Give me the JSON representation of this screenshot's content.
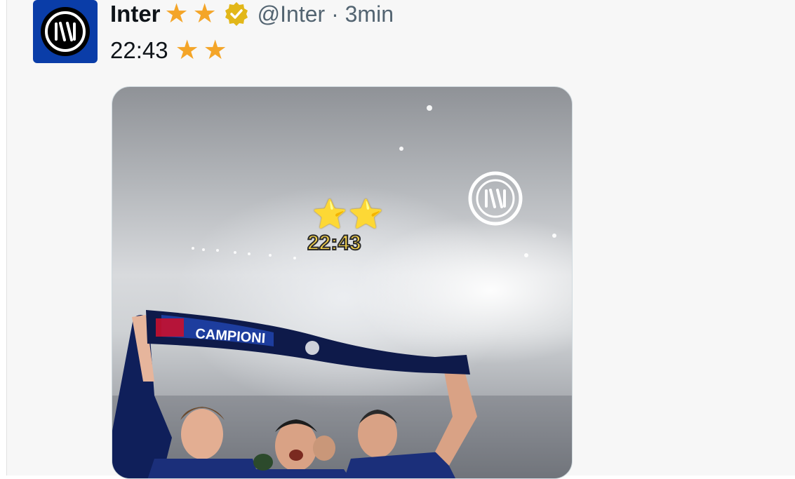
{
  "post": {
    "author_name": "Inter",
    "name_stars": "★",
    "handle_time": "@Inter · 3min",
    "text": "22:43",
    "text_stars": "★"
  },
  "media": {
    "overlay_stars": "⭐⭐",
    "overlay_time": "22:43",
    "scarf_text": "CAMPIONI"
  },
  "colors": {
    "inter_blue": "#0a3da8",
    "star": "#f4a528",
    "verified": "#e2b719",
    "handle_gray": "#536471"
  }
}
